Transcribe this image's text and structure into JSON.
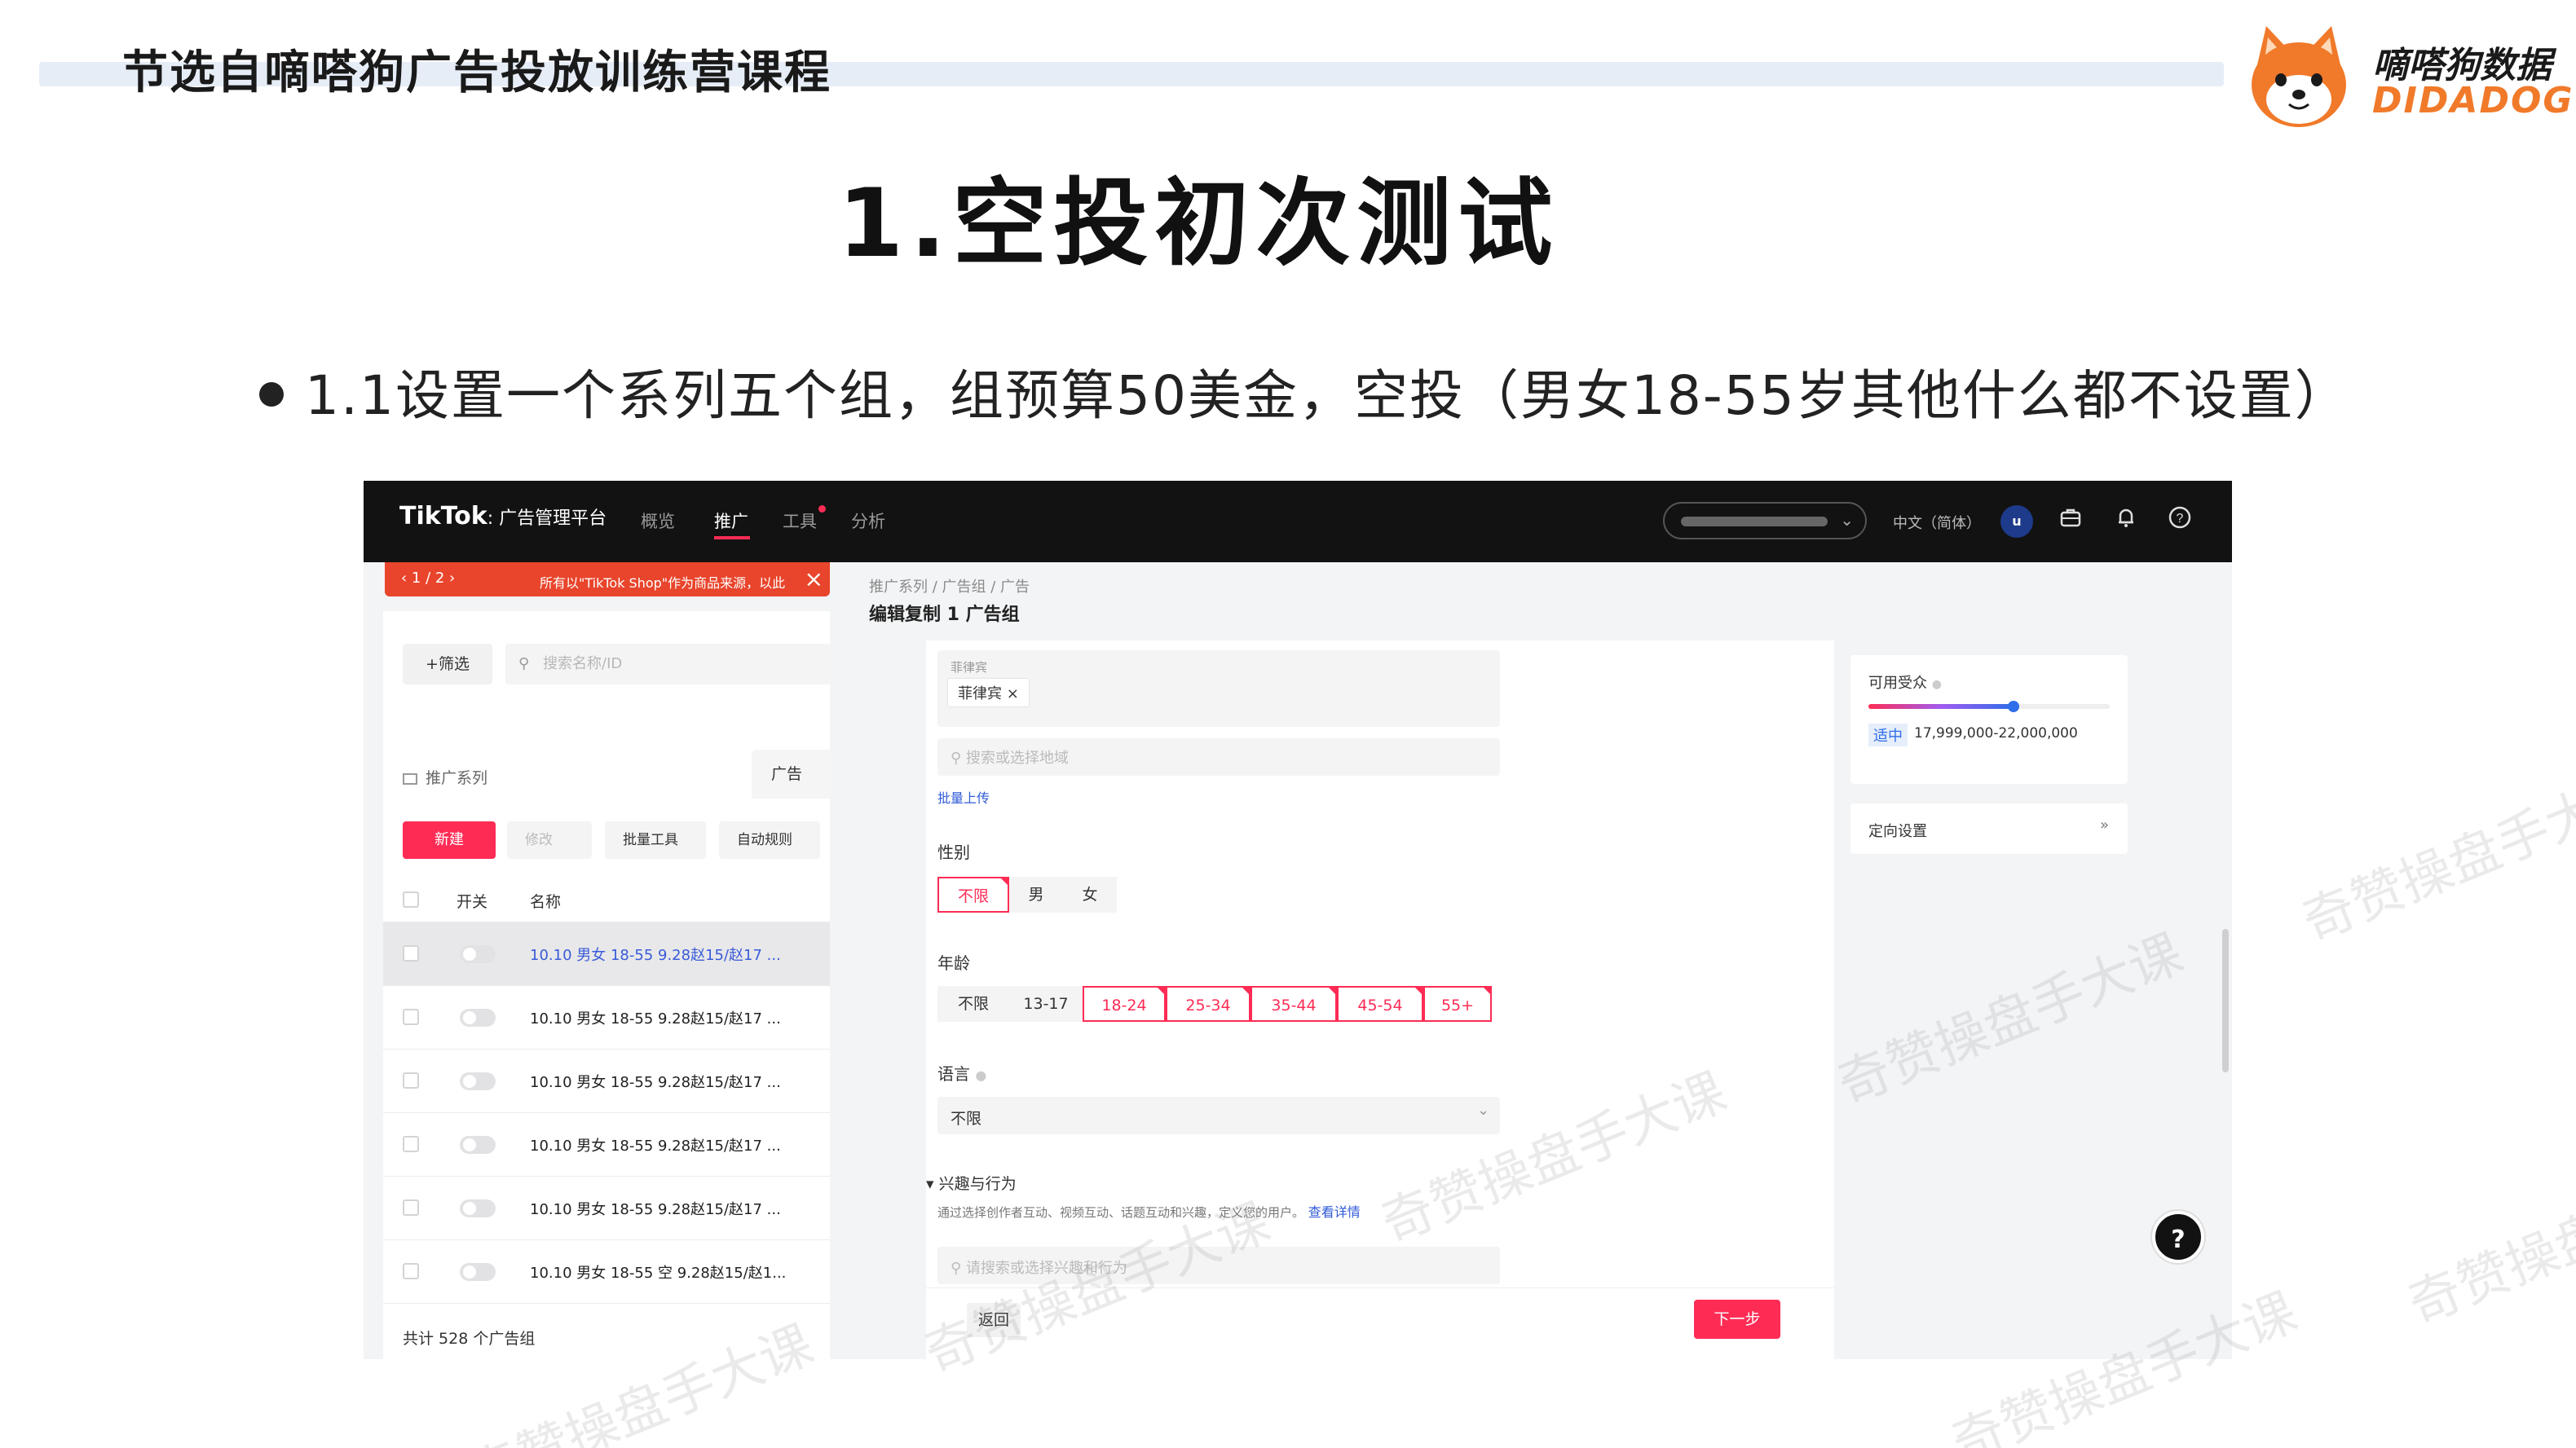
{
  "slide": {
    "course_title": "节选自嘀嗒狗广告投放训练营课程",
    "main_title": "1.空投初次测试",
    "bullet": "1.1设置一个系列五个组，组预算50美金，空投（男女18-55岁其他什么都不设置）"
  },
  "logo": {
    "cn": "嘀嗒狗数据",
    "en": "DIDADOG",
    "color": "#f07a2a"
  },
  "watermark": "奇赞操盘手大课",
  "tiktok": {
    "brand": "TikTok",
    "brand_sub": ": 广告管理平台",
    "nav": [
      "概览",
      "推广",
      "工具",
      "分析"
    ],
    "nav_active": "推广",
    "language": "中文（简体）",
    "avatar": "u",
    "accent": "#fe2c55",
    "notice": {
      "pager": "‹  1 / 2  ›",
      "text": "所有以\"TikTok Shop\"作为商品来源，以此"
    },
    "left": {
      "filter_btn": "+筛选",
      "search_placeholder": "搜索名称/ID",
      "campaign_label": "推广系列",
      "ad_tab": "广告",
      "new_btn": "新建",
      "edit_btn": "修改",
      "bulk_btn": "批量工具",
      "rules_btn": "自动规则",
      "col_switch": "开关",
      "col_name": "名称",
      "rows": [
        "10.10 男女 18-55 9.28赵15/赵17 ...",
        "10.10 男女 18-55 9.28赵15/赵17 ...",
        "10.10 男女 18-55 9.28赵15/赵17 ...",
        "10.10 男女 18-55 9.28赵15/赵17 ...",
        "10.10 男女 18-55 9.28赵15/赵17 ...",
        "10.10 男女 18-55 空 9.28赵15/赵1..."
      ],
      "total": "共计 528 个广告组"
    },
    "form": {
      "breadcrumb": "推广系列 / 广告组 / 广告",
      "page_title": "编辑复制 1 广告组",
      "location_label": "菲律宾",
      "location_tag": "菲律宾 ×",
      "location_search": "搜索或选择地域",
      "bulk_upload": "批量上传",
      "gender_label": "性别",
      "gender_options": [
        "不限",
        "男",
        "女"
      ],
      "gender_selected": "不限",
      "age_label": "年龄",
      "age_options": [
        "不限",
        "13-17",
        "18-24",
        "25-34",
        "35-44",
        "45-54",
        "55+"
      ],
      "age_selected": [
        "18-24",
        "25-34",
        "35-44",
        "45-54",
        "55+"
      ],
      "language_label": "语言",
      "language_value": "不限",
      "interest_label": "兴趣与行为",
      "interest_desc": "通过选择创作者互动、视频互动、话题互动和兴趣，定义您的用户。",
      "interest_link": "查看详情",
      "interest_search": "请搜索或选择兴趣和行为",
      "back_btn": "返回",
      "next_btn": "下一步"
    },
    "right": {
      "audience_label": "可用受众",
      "audience_badge": "适中",
      "audience_value": "17,999,000-22,000,000",
      "audience_level": 0.6,
      "targeting_label": "定向设置"
    }
  }
}
